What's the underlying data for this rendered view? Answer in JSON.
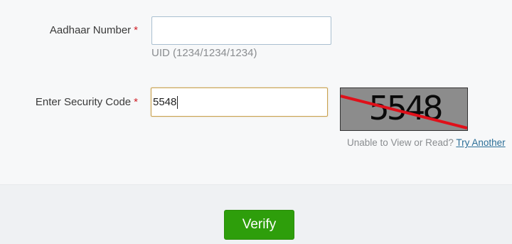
{
  "form": {
    "aadhaar": {
      "label": "Aadhaar Number",
      "required_mark": "*",
      "value": "",
      "hint": "UID (1234/1234/1234)"
    },
    "security_code": {
      "label": "Enter Security Code",
      "required_mark": "*",
      "value": "5548"
    },
    "captcha": {
      "text": "5548",
      "background_color": "#8c8c8c",
      "strike_color": "#e0101a"
    },
    "captcha_help": {
      "text": "Unable to View or Read?",
      "link_label": "Try Another"
    }
  },
  "actions": {
    "verify_label": "Verify",
    "verify_color": "#2e9e0b"
  },
  "colors": {
    "required": "#d02027",
    "link": "#2c6f98",
    "focus_border": "#c9a14e"
  }
}
